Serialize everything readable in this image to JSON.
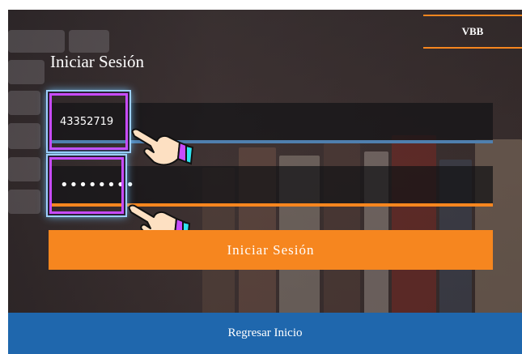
{
  "brand": "VBB",
  "login": {
    "title": "Iniciar Sesión",
    "username_value": "43352719",
    "password_value": "••••••••",
    "submit_label": "Iniciar Sesión"
  },
  "footer": {
    "back_label": "Regresar Inicio"
  },
  "colors": {
    "accent_orange": "#f6861f",
    "footer_blue": "#1f67ad",
    "underline_blue": "#4f7fae",
    "highlight_purple": "#c84bff"
  },
  "icons": [
    "pointing-hand-icon",
    "pointing-hand-icon"
  ]
}
